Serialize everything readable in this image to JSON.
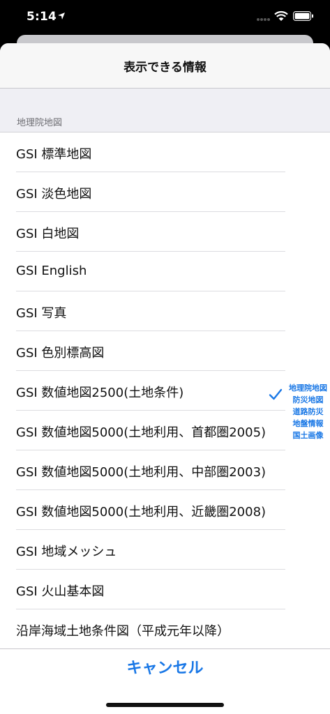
{
  "status_bar": {
    "time": "5:14"
  },
  "sheet": {
    "title": "表示できる情報",
    "section_header": "地理院地図",
    "items": [
      {
        "label": "GSI 標準地図"
      },
      {
        "label": "GSI 淡色地図"
      },
      {
        "label": "GSI 白地図"
      },
      {
        "label": "GSI English"
      },
      {
        "label": "GSI 写真"
      },
      {
        "label": "GSI 色別標高図",
        "selected": true
      },
      {
        "label": "GSI 数値地図2500(土地条件)"
      },
      {
        "label": "GSI 数値地図5000(土地利用、首都圏2005)"
      },
      {
        "label": "GSI 数値地図5000(土地利用、中部圏2003)"
      },
      {
        "label": "GSI 数値地図5000(土地利用、近畿圏2008)"
      },
      {
        "label": "GSI 地域メッシュ"
      },
      {
        "label": "GSI 火山基本図"
      },
      {
        "label": "沿岸海域土地条件図（平成元年以降）"
      }
    ],
    "side_index": [
      "地理院地図",
      "防災地図",
      "道路防災",
      "地盤情報",
      "国土画像"
    ],
    "cancel_label": "キャンセル"
  },
  "colors": {
    "accent": "#1a78e6",
    "header_bg": "#f7f7f7",
    "section_bg": "#efeff4"
  }
}
